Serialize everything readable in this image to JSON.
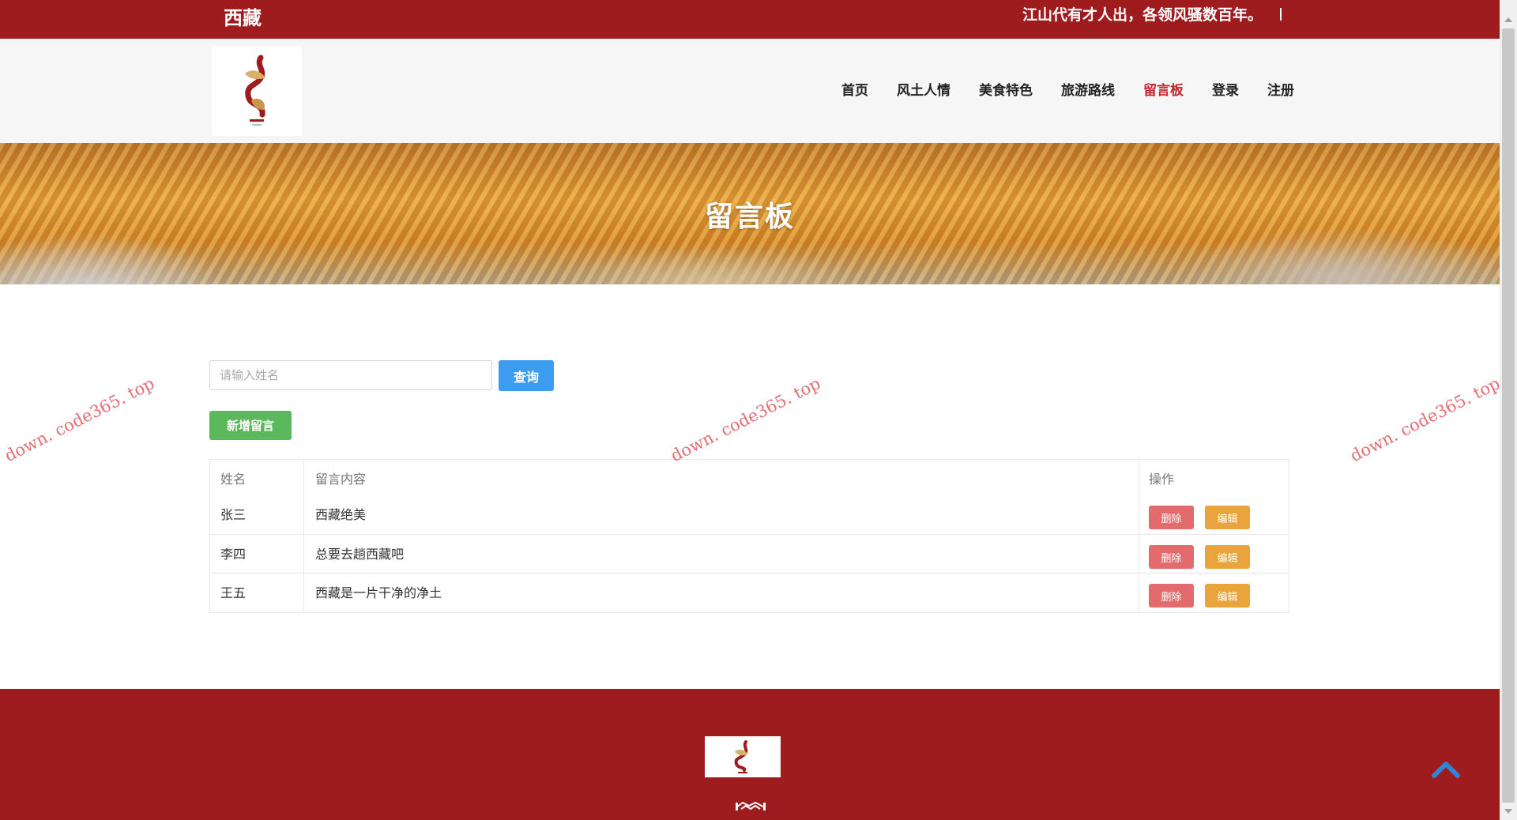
{
  "topbar": {
    "brand": "西藏",
    "slogan": "江山代有才人出，各领风骚数百年。"
  },
  "nav": {
    "items": [
      {
        "label": "首页"
      },
      {
        "label": "风土人情"
      },
      {
        "label": "美食特色"
      },
      {
        "label": "旅游路线"
      },
      {
        "label": "留言板",
        "active": true
      },
      {
        "label": "登录"
      },
      {
        "label": "注册"
      }
    ]
  },
  "banner": {
    "title": "留言板"
  },
  "search": {
    "placeholder": "请输入姓名",
    "value": "",
    "button_label": "查询"
  },
  "add_button_label": "新增留言",
  "table": {
    "headers": {
      "name": "姓名",
      "content": "留言内容",
      "ops": "操作"
    },
    "rows": [
      {
        "name": "张三",
        "content": "西藏绝美",
        "delete": "删除",
        "edit": "编辑"
      },
      {
        "name": "李四",
        "content": "总要去趟西藏吧",
        "delete": "删除",
        "edit": "编辑"
      },
      {
        "name": "王五",
        "content": "西藏是一片干净的净土",
        "delete": "删除",
        "edit": "编辑"
      }
    ]
  },
  "watermark": "down. code365. top",
  "colors": {
    "brand_red": "#9e1b1e",
    "primary_blue": "#3c9cef",
    "success_green": "#5cb85c",
    "danger": "#e46b6d",
    "warning": "#e9a53c",
    "active_nav": "#c1272d"
  },
  "icons": {
    "back_to_top": "chevron-up-icon"
  }
}
